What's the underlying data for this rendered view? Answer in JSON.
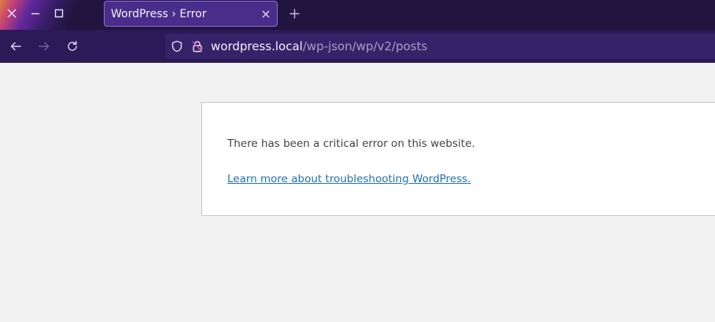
{
  "window": {
    "controls": [
      "close-icon",
      "minimize-icon",
      "maximize-icon"
    ]
  },
  "tabs": [
    {
      "title": "WordPress › Error",
      "active": true
    }
  ],
  "address_bar": {
    "url_domain": "wordpress.local",
    "url_path": "/wp-json/wp/v2/posts"
  },
  "page": {
    "message": "There has been a critical error on this website.",
    "link_text": "Learn more about troubleshooting WordPress."
  },
  "colors": {
    "titlebar": "#21143f",
    "tab_active": "#4a2d8a",
    "navbar": "#2b1a57",
    "urlbar": "#35236a",
    "page_background": "#f1f1f1",
    "link": "#2271b1",
    "insecure_lock": "#e0479e"
  }
}
